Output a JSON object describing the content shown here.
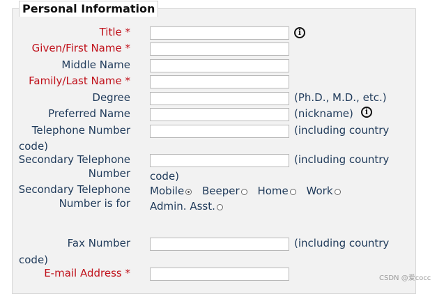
{
  "section": {
    "legend": "Personal Information"
  },
  "fields": {
    "title": {
      "label": "Title *",
      "value": ""
    },
    "given_name": {
      "label": "Given/First Name *",
      "value": ""
    },
    "middle_name": {
      "label": "Middle Name",
      "value": ""
    },
    "family_name": {
      "label": "Family/Last Name *",
      "value": ""
    },
    "degree": {
      "label": "Degree",
      "value": "",
      "hint": "(Ph.D., M.D., etc.)"
    },
    "preferred_name": {
      "label": "Preferred Name",
      "value": "",
      "hint": "(nickname)"
    },
    "telephone": {
      "label": "Telephone Number",
      "value": "",
      "hint": "(including country",
      "hint_cont": "code)"
    },
    "secondary_phone": {
      "label": "Secondary Telephone Number",
      "value": "",
      "hint": "(including country",
      "hint_cont": "code)"
    },
    "secondary_phone_type": {
      "label": "Secondary Telephone Number is for",
      "options": [
        "Mobile",
        "Beeper",
        "Home",
        "Work",
        "Admin. Asst."
      ],
      "selected": "Mobile"
    },
    "fax": {
      "label": "Fax Number",
      "value": "",
      "hint": "(including country",
      "hint_cont": "code)"
    },
    "email": {
      "label": "E-mail Address *",
      "value": ""
    }
  },
  "icons": {
    "title_info": "info-circle-icon",
    "preferred_info": "info-circle-icon"
  },
  "colors": {
    "required_label": "#c0101a",
    "label": "#1f3a5a",
    "panel_bg": "#f2f2f2"
  },
  "watermark": "CSDN @爱cocc"
}
